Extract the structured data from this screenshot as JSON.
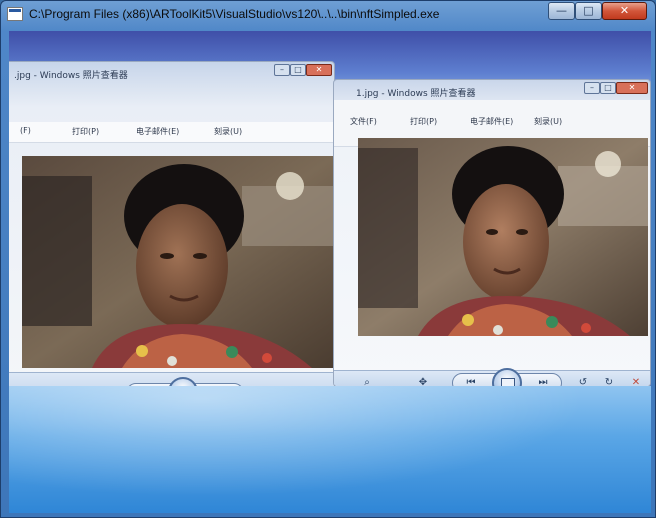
{
  "window": {
    "title": "C:\\Program Files (x86)\\ARToolKit5\\VisualStudio\\vs120\\..\\..\\bin\\nftSimpled.exe",
    "controls": {
      "minimize": "—",
      "maximize": "□",
      "close": "✕"
    }
  },
  "viewer_left": {
    "title": ".jpg - Windows 照片查看器",
    "menu": [
      "(F)",
      "打印(P)",
      "电子邮件(E)",
      "刻录(U)"
    ]
  },
  "viewer_right": {
    "title": "1.jpg - Windows 照片查看器",
    "menu": [
      "文件(F)",
      "打印(P)",
      "电子邮件(E)",
      "刻录(U)"
    ]
  },
  "toolbar_icons": {
    "zoom": "⌕",
    "fit": "✥",
    "prev": "⏮",
    "next": "⏭",
    "rotate_left": "↺",
    "rotate_right": "↻",
    "delete": "✕"
  },
  "colors": {
    "titlebar": "#4f87c8",
    "desk": "#5aa6e6",
    "photo_bg": "#3a2e24"
  }
}
